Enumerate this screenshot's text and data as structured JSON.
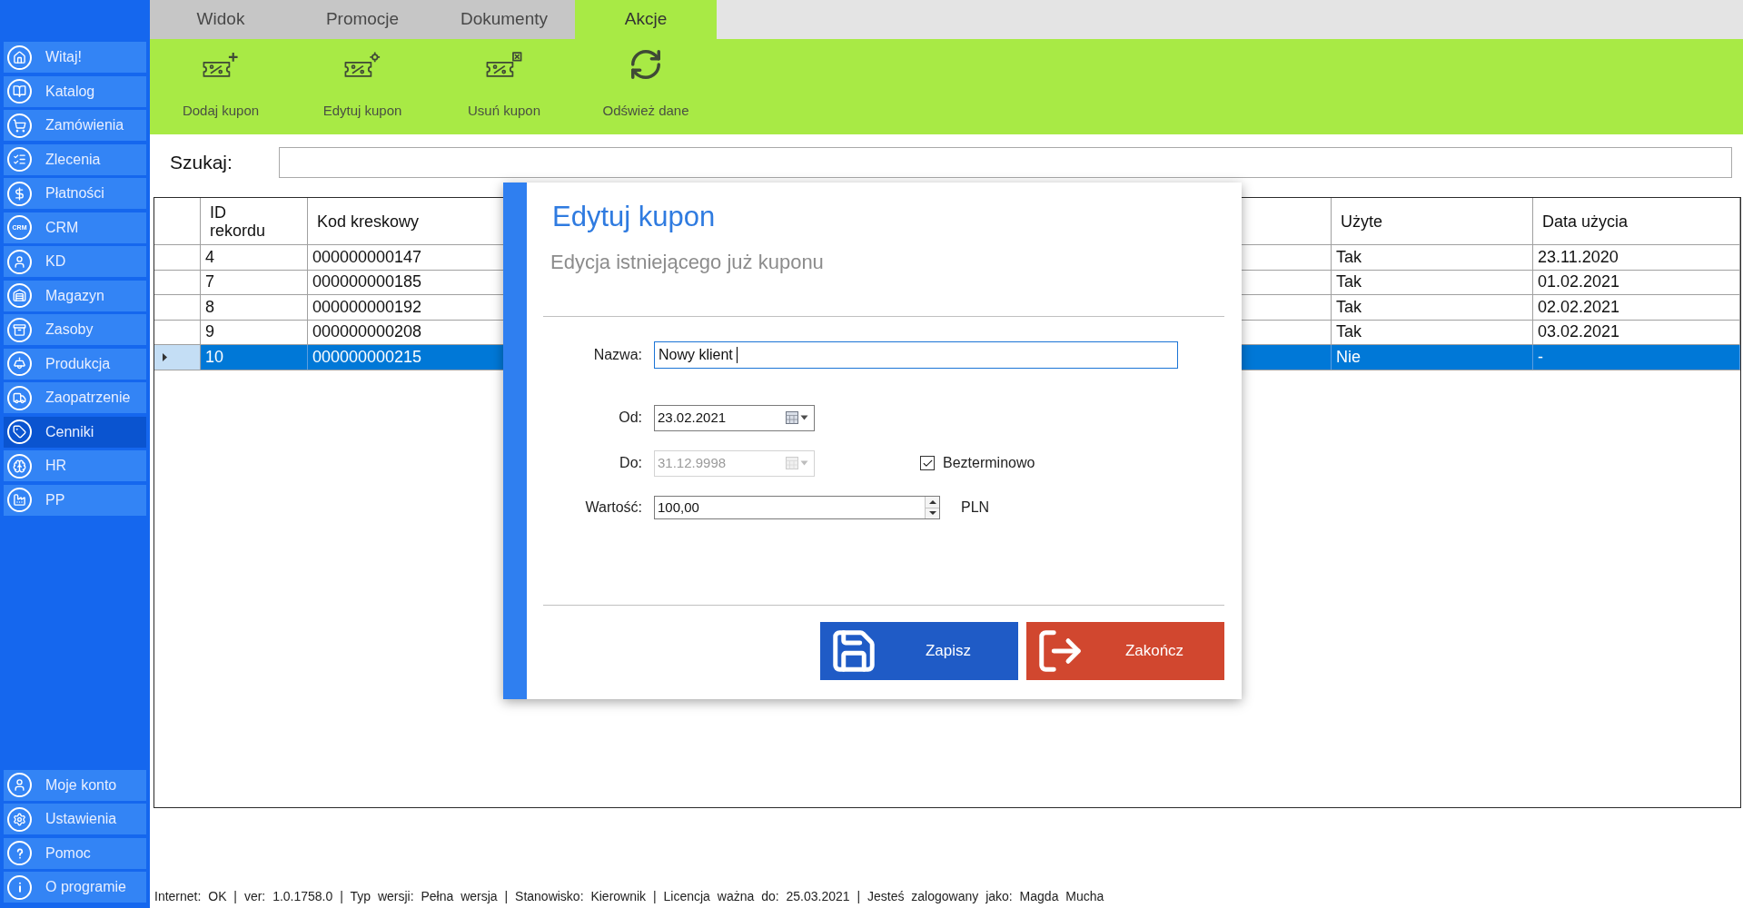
{
  "sidebar": {
    "items": [
      {
        "label": "Witaj!",
        "selected": false
      },
      {
        "label": "Katalog",
        "selected": false
      },
      {
        "label": "Zamówienia",
        "selected": false
      },
      {
        "label": "Zlecenia",
        "selected": false
      },
      {
        "label": "Płatności",
        "selected": false
      },
      {
        "label": "CRM",
        "icon_text": "CRM",
        "selected": false
      },
      {
        "label": "KD",
        "selected": false
      },
      {
        "label": "Magazyn",
        "selected": false
      },
      {
        "label": "Zasoby",
        "selected": false
      },
      {
        "label": "Produkcja",
        "selected": false
      },
      {
        "label": "Zaopatrzenie",
        "selected": false
      },
      {
        "label": "Cenniki",
        "selected": true
      },
      {
        "label": "HR",
        "selected": false
      },
      {
        "label": "PP",
        "selected": false
      }
    ],
    "bottom_items": [
      {
        "label": "Moje konto",
        "selected": false
      },
      {
        "label": "Ustawienia",
        "selected": false
      },
      {
        "label": "Pomoc",
        "selected": false
      },
      {
        "label": "O programie",
        "selected": false
      }
    ]
  },
  "tabs": [
    {
      "label": "Widok",
      "selected": false
    },
    {
      "label": "Promocje",
      "selected": false
    },
    {
      "label": "Dokumenty",
      "selected": false
    },
    {
      "label": "Akcje",
      "selected": true
    }
  ],
  "toolbar": {
    "buttons": [
      {
        "label": "Dodaj kupon"
      },
      {
        "label": "Edytuj kupon"
      },
      {
        "label": "Usuń kupon"
      },
      {
        "label": "Odśwież dane"
      }
    ]
  },
  "search": {
    "label": "Szukaj:"
  },
  "table": {
    "columns": [
      {
        "label": "ID rekordu"
      },
      {
        "label": "Kod kreskowy"
      },
      {
        "label": "Użyte"
      },
      {
        "label": "Data użycia"
      }
    ],
    "rows": [
      {
        "cells": [
          "4",
          "000000000147",
          "Tak",
          "23.11.2020"
        ],
        "selected": false
      },
      {
        "cells": [
          "7",
          "000000000185",
          "Tak",
          "01.02.2021"
        ],
        "selected": false
      },
      {
        "cells": [
          "8",
          "000000000192",
          "Tak",
          "02.02.2021"
        ],
        "selected": false
      },
      {
        "cells": [
          "9",
          "000000000208",
          "Tak",
          "03.02.2021"
        ],
        "selected": false
      },
      {
        "cells": [
          "10",
          "000000000215",
          "Nie",
          "-"
        ],
        "selected": true
      }
    ]
  },
  "dialog": {
    "title": "Edytuj kupon",
    "subtitle": "Edycja istniejącego już kuponu",
    "fields": [
      {
        "kind": "text",
        "label": "Nazwa:",
        "value": "Nowy klient",
        "focused": true,
        "disabled": false
      },
      {
        "kind": "date",
        "label": "Od:",
        "value": "23.02.2021",
        "focused": false,
        "disabled": false
      },
      {
        "kind": "date",
        "label": "Do:",
        "value": "31.12.9998",
        "focused": false,
        "disabled": true,
        "option": {
          "label": "Bezterminowo",
          "checked": true
        }
      },
      {
        "kind": "number",
        "label": "Wartość:",
        "value": "100,00",
        "unit": "PLN",
        "focused": false,
        "disabled": false
      }
    ],
    "buttons": [
      {
        "kind": "save",
        "label": "Zapisz"
      },
      {
        "kind": "close",
        "label": "Zakończ"
      }
    ]
  },
  "status_bar": {
    "text": "Internet: OK | ver: 1.0.1758.0 | Typ wersji: Pełna wersja | Stanowisko: Kierownik | Licencja ważna do: 25.03.2021 | Jesteś zalogowany jako: Magda Mucha"
  }
}
